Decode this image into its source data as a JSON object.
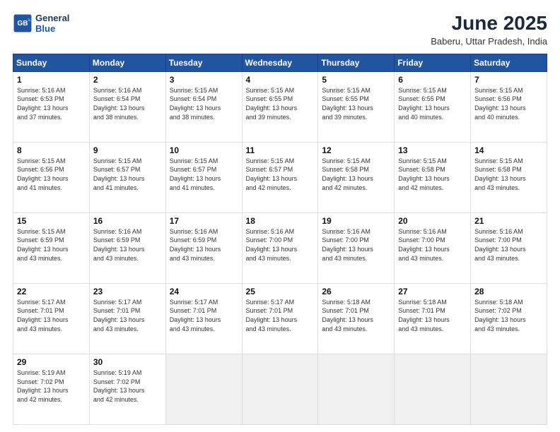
{
  "header": {
    "logo_line1": "General",
    "logo_line2": "Blue",
    "month_year": "June 2025",
    "location": "Baberu, Uttar Pradesh, India"
  },
  "weekdays": [
    "Sunday",
    "Monday",
    "Tuesday",
    "Wednesday",
    "Thursday",
    "Friday",
    "Saturday"
  ],
  "days": [
    {
      "day": "",
      "info": ""
    },
    {
      "day": "",
      "info": ""
    },
    {
      "day": "",
      "info": ""
    },
    {
      "day": "",
      "info": ""
    },
    {
      "day": "",
      "info": ""
    },
    {
      "day": "",
      "info": ""
    },
    {
      "day": "7",
      "info": "Sunrise: 5:15 AM\nSunset: 6:56 PM\nDaylight: 13 hours\nand 40 minutes."
    },
    {
      "day": "1",
      "info": "Sunrise: 5:16 AM\nSunset: 6:53 PM\nDaylight: 13 hours\nand 37 minutes."
    },
    {
      "day": "2",
      "info": "Sunrise: 5:16 AM\nSunset: 6:54 PM\nDaylight: 13 hours\nand 38 minutes."
    },
    {
      "day": "3",
      "info": "Sunrise: 5:15 AM\nSunset: 6:54 PM\nDaylight: 13 hours\nand 38 minutes."
    },
    {
      "day": "4",
      "info": "Sunrise: 5:15 AM\nSunset: 6:55 PM\nDaylight: 13 hours\nand 39 minutes."
    },
    {
      "day": "5",
      "info": "Sunrise: 5:15 AM\nSunset: 6:55 PM\nDaylight: 13 hours\nand 39 minutes."
    },
    {
      "day": "6",
      "info": "Sunrise: 5:15 AM\nSunset: 6:55 PM\nDaylight: 13 hours\nand 40 minutes."
    },
    {
      "day": "7",
      "info": "Sunrise: 5:15 AM\nSunset: 6:56 PM\nDaylight: 13 hours\nand 40 minutes."
    },
    {
      "day": "8",
      "info": "Sunrise: 5:15 AM\nSunset: 6:56 PM\nDaylight: 13 hours\nand 41 minutes."
    },
    {
      "day": "9",
      "info": "Sunrise: 5:15 AM\nSunset: 6:57 PM\nDaylight: 13 hours\nand 41 minutes."
    },
    {
      "day": "10",
      "info": "Sunrise: 5:15 AM\nSunset: 6:57 PM\nDaylight: 13 hours\nand 41 minutes."
    },
    {
      "day": "11",
      "info": "Sunrise: 5:15 AM\nSunset: 6:57 PM\nDaylight: 13 hours\nand 42 minutes."
    },
    {
      "day": "12",
      "info": "Sunrise: 5:15 AM\nSunset: 6:58 PM\nDaylight: 13 hours\nand 42 minutes."
    },
    {
      "day": "13",
      "info": "Sunrise: 5:15 AM\nSunset: 6:58 PM\nDaylight: 13 hours\nand 42 minutes."
    },
    {
      "day": "14",
      "info": "Sunrise: 5:15 AM\nSunset: 6:58 PM\nDaylight: 13 hours\nand 43 minutes."
    },
    {
      "day": "15",
      "info": "Sunrise: 5:15 AM\nSunset: 6:59 PM\nDaylight: 13 hours\nand 43 minutes."
    },
    {
      "day": "16",
      "info": "Sunrise: 5:16 AM\nSunset: 6:59 PM\nDaylight: 13 hours\nand 43 minutes."
    },
    {
      "day": "17",
      "info": "Sunrise: 5:16 AM\nSunset: 6:59 PM\nDaylight: 13 hours\nand 43 minutes."
    },
    {
      "day": "18",
      "info": "Sunrise: 5:16 AM\nSunset: 7:00 PM\nDaylight: 13 hours\nand 43 minutes."
    },
    {
      "day": "19",
      "info": "Sunrise: 5:16 AM\nSunset: 7:00 PM\nDaylight: 13 hours\nand 43 minutes."
    },
    {
      "day": "20",
      "info": "Sunrise: 5:16 AM\nSunset: 7:00 PM\nDaylight: 13 hours\nand 43 minutes."
    },
    {
      "day": "21",
      "info": "Sunrise: 5:16 AM\nSunset: 7:00 PM\nDaylight: 13 hours\nand 43 minutes."
    },
    {
      "day": "22",
      "info": "Sunrise: 5:17 AM\nSunset: 7:01 PM\nDaylight: 13 hours\nand 43 minutes."
    },
    {
      "day": "23",
      "info": "Sunrise: 5:17 AM\nSunset: 7:01 PM\nDaylight: 13 hours\nand 43 minutes."
    },
    {
      "day": "24",
      "info": "Sunrise: 5:17 AM\nSunset: 7:01 PM\nDaylight: 13 hours\nand 43 minutes."
    },
    {
      "day": "25",
      "info": "Sunrise: 5:17 AM\nSunset: 7:01 PM\nDaylight: 13 hours\nand 43 minutes."
    },
    {
      "day": "26",
      "info": "Sunrise: 5:18 AM\nSunset: 7:01 PM\nDaylight: 13 hours\nand 43 minutes."
    },
    {
      "day": "27",
      "info": "Sunrise: 5:18 AM\nSunset: 7:01 PM\nDaylight: 13 hours\nand 43 minutes."
    },
    {
      "day": "28",
      "info": "Sunrise: 5:18 AM\nSunset: 7:02 PM\nDaylight: 13 hours\nand 43 minutes."
    },
    {
      "day": "29",
      "info": "Sunrise: 5:19 AM\nSunset: 7:02 PM\nDaylight: 13 hours\nand 42 minutes."
    },
    {
      "day": "30",
      "info": "Sunrise: 5:19 AM\nSunset: 7:02 PM\nDaylight: 13 hours\nand 42 minutes."
    },
    {
      "day": "",
      "info": ""
    },
    {
      "day": "",
      "info": ""
    },
    {
      "day": "",
      "info": ""
    },
    {
      "day": "",
      "info": ""
    },
    {
      "day": "",
      "info": ""
    }
  ]
}
